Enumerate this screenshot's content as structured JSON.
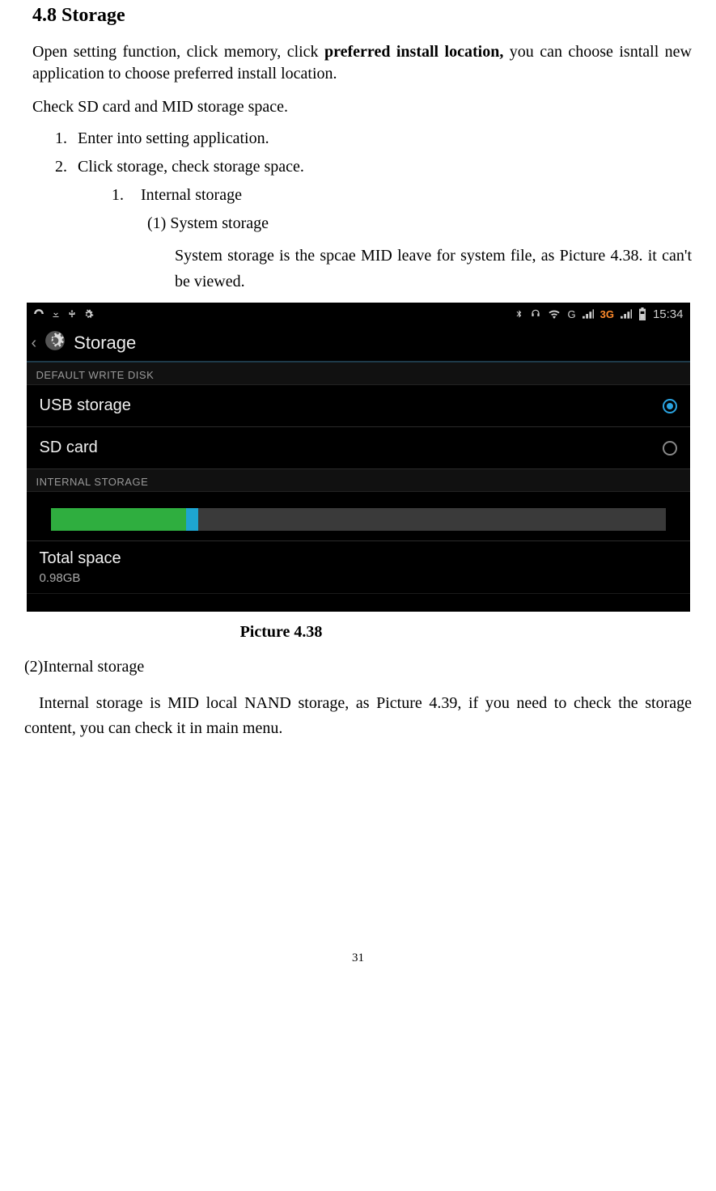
{
  "heading": "4.8 Storage",
  "para1_a": "Open setting function, click memory, click ",
  "para1_b": "preferred install location, ",
  "para1_c": "you can choose isntall new application to choose preferred install location.",
  "para2": "Check SD card and MID storage space.",
  "list1": {
    "item1_num": "1.",
    "item1": "Enter into setting application.",
    "item2_num": "2.",
    "item2": "Click storage, check storage space."
  },
  "sublist": {
    "num": "1.",
    "text": "Internal storage",
    "subsub_num": "(1)",
    "subsub_text": "System storage",
    "body": "System storage is the spcae MID leave for system file, as Picture 4.38. it can't be viewed."
  },
  "screenshot": {
    "status": {
      "time": "15:34",
      "threeg": "3G"
    },
    "title": "Storage",
    "section1": "DEFAULT WRITE DISK",
    "row_usb": "USB storage",
    "row_sd": "SD card",
    "section2": "INTERNAL STORAGE",
    "bar": {
      "seg1_pct": 22,
      "seg2_pct": 2
    },
    "total_label": "Total space",
    "total_value": "0.98GB"
  },
  "caption": "Picture 4.38",
  "para3": "(2)Internal storage",
  "para4": "Internal storage is MID local NAND storage, as Picture 4.39, if you need to check the storage content, you can check it in main menu.",
  "page_number": "31"
}
